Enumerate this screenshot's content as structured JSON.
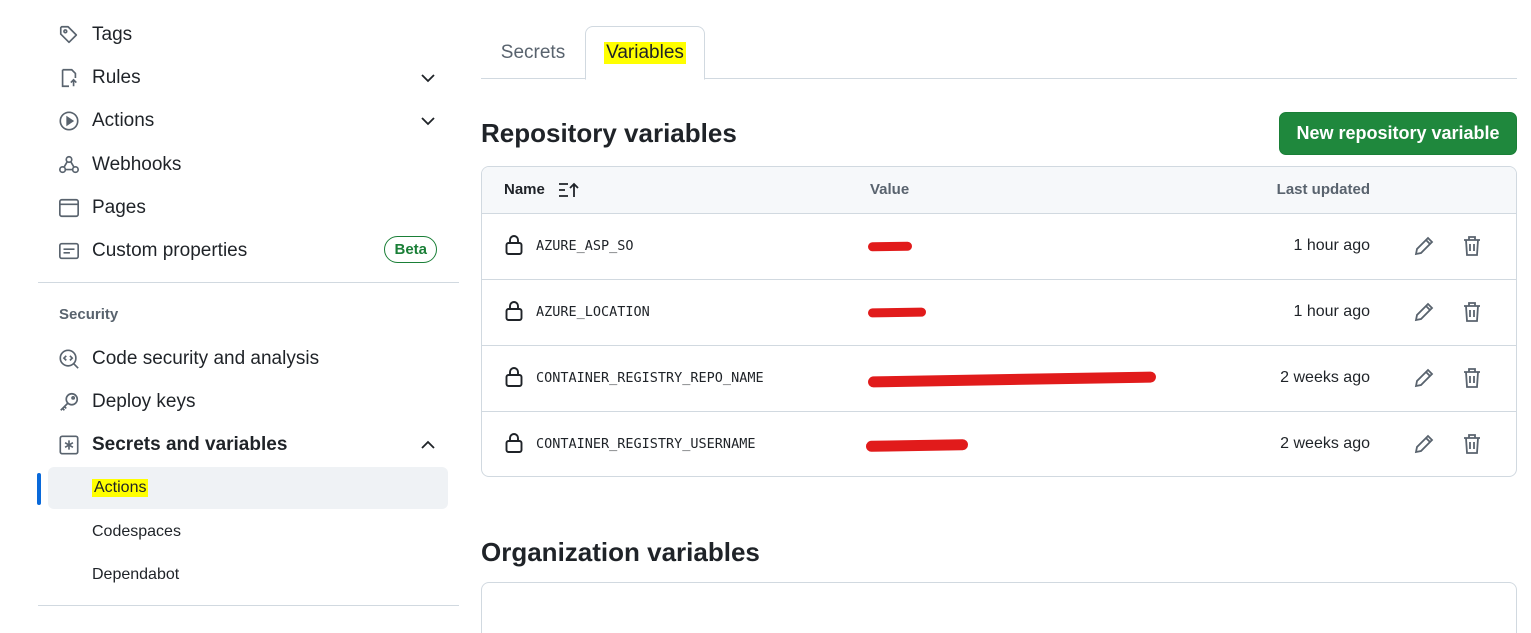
{
  "sidebar": {
    "items": [
      {
        "label": "Tags",
        "icon": "tag-icon"
      },
      {
        "label": "Rules",
        "icon": "rules-icon"
      },
      {
        "label": "Actions",
        "icon": "play-icon"
      },
      {
        "label": "Webhooks",
        "icon": "webhook-icon"
      },
      {
        "label": "Pages",
        "icon": "browser-icon"
      },
      {
        "label": "Custom properties",
        "icon": "note-icon",
        "badge": "Beta"
      }
    ],
    "security_title": "Security",
    "security_items": [
      {
        "label": "Code security and analysis",
        "icon": "codescan-icon"
      },
      {
        "label": "Deploy keys",
        "icon": "key-icon"
      },
      {
        "label": "Secrets and variables",
        "icon": "asterisk-icon"
      }
    ],
    "sub_items": [
      {
        "label": "Actions"
      },
      {
        "label": "Codespaces"
      },
      {
        "label": "Dependabot"
      }
    ]
  },
  "tabs": [
    {
      "label": "Secrets"
    },
    {
      "label": "Variables"
    }
  ],
  "repo_section": {
    "title": "Repository variables",
    "new_button": "New repository variable",
    "columns": {
      "name": "Name",
      "value": "Value",
      "updated": "Last updated"
    },
    "rows": [
      {
        "name": "AZURE_ASP_SO",
        "updated": "1 hour ago"
      },
      {
        "name": "AZURE_LOCATION",
        "updated": "1 hour ago"
      },
      {
        "name": "CONTAINER_REGISTRY_REPO_NAME",
        "updated": "2 weeks ago"
      },
      {
        "name": "CONTAINER_REGISTRY_USERNAME",
        "updated": "2 weeks ago"
      }
    ]
  },
  "org_section": {
    "title": "Organization variables"
  },
  "colors": {
    "primary_button": "#1f883d",
    "active_indicator": "#0969da",
    "highlight": "#ffff00",
    "redaction": "#e11b1b",
    "beta_badge": "#1a7f37"
  }
}
